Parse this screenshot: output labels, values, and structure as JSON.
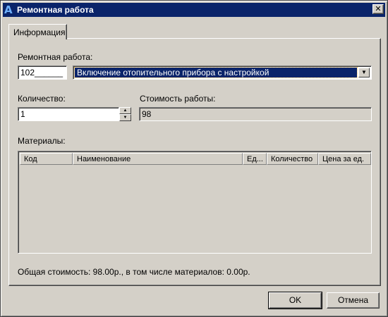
{
  "window": {
    "title": "Ремонтная работа",
    "close_glyph": "✕"
  },
  "tab": {
    "label": "Информация"
  },
  "repair_work": {
    "label": "Ремонтная работа:",
    "code": "102______",
    "selected": "Включение отопительного прибора  с настройкой",
    "arrow": "▼"
  },
  "quantity": {
    "label": "Количество:",
    "value": "1"
  },
  "work_cost": {
    "label": "Стоимость работы:",
    "value": "98"
  },
  "materials": {
    "label": "Материалы:",
    "columns": [
      "Код",
      "Наименование",
      "Ед...",
      "Количество",
      "Цена за ед."
    ]
  },
  "total_text": "Общая стоимость: 98.00р., в том числе материалов: 0.00р.",
  "buttons": {
    "ok": "OK",
    "cancel": "Отмена"
  }
}
